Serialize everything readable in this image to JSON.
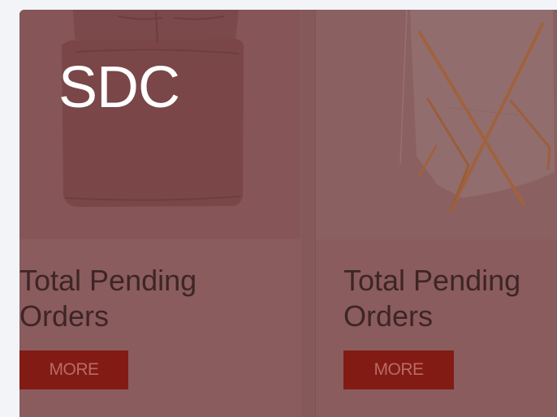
{
  "brand": {
    "logo_text": "SDC"
  },
  "cards": [
    {
      "title_line1": "Total Pending",
      "title_line2": "Orders",
      "button_label": "MORE",
      "image": "bedding-product-image"
    },
    {
      "title_line1": "Total Pending",
      "title_line2": "Orders",
      "button_label": "MORE",
      "image": "folding-chair-product-image"
    }
  ],
  "colors": {
    "overlay": "#8a5c5e",
    "button": "#821b14",
    "button_text": "#b86b65",
    "title_text": "#3e2526",
    "page_background": "#f2f4f8"
  }
}
